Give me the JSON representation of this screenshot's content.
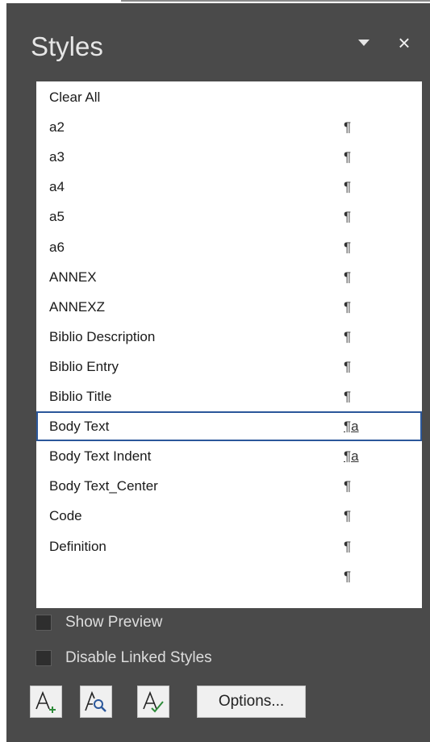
{
  "pane": {
    "title": "Styles",
    "dropdown_icon": "triangle-down-icon",
    "close_icon": "close-icon",
    "close_glyph": "×"
  },
  "styles": {
    "selected": "Body Text",
    "items": [
      {
        "label": "Clear All",
        "marker": ""
      },
      {
        "label": "a2",
        "marker": "¶"
      },
      {
        "label": "a3",
        "marker": "¶"
      },
      {
        "label": "a4",
        "marker": "¶"
      },
      {
        "label": "a5",
        "marker": "¶"
      },
      {
        "label": "a6",
        "marker": "¶"
      },
      {
        "label": "ANNEX",
        "marker": "¶"
      },
      {
        "label": "ANNEXZ",
        "marker": "¶"
      },
      {
        "label": "Biblio Description",
        "marker": "¶"
      },
      {
        "label": "Biblio Entry",
        "marker": "¶"
      },
      {
        "label": "Biblio Title",
        "marker": "¶"
      },
      {
        "label": "Body Text",
        "marker": "¶a"
      },
      {
        "label": "Body Text Indent",
        "marker": "¶a"
      },
      {
        "label": "Body Text_Center",
        "marker": "¶"
      },
      {
        "label": "Code",
        "marker": "¶"
      },
      {
        "label": "Definition",
        "marker": "¶"
      },
      {
        "label": "",
        "marker": "¶"
      }
    ]
  },
  "options": {
    "show_preview": {
      "label": "Show Preview",
      "checked": false
    },
    "disable_linked": {
      "label": "Disable Linked Styles",
      "checked": false
    }
  },
  "buttons": {
    "new_style_icon": "new-style-icon",
    "style_inspector_icon": "style-inspector-icon",
    "manage_styles_icon": "manage-styles-icon",
    "options_label": "Options..."
  },
  "colors": {
    "pane_bg": "#4a4a4a",
    "selection_border": "#2b579a",
    "icon_accent": "#2b579a",
    "icon_green": "#2e8b3a"
  }
}
